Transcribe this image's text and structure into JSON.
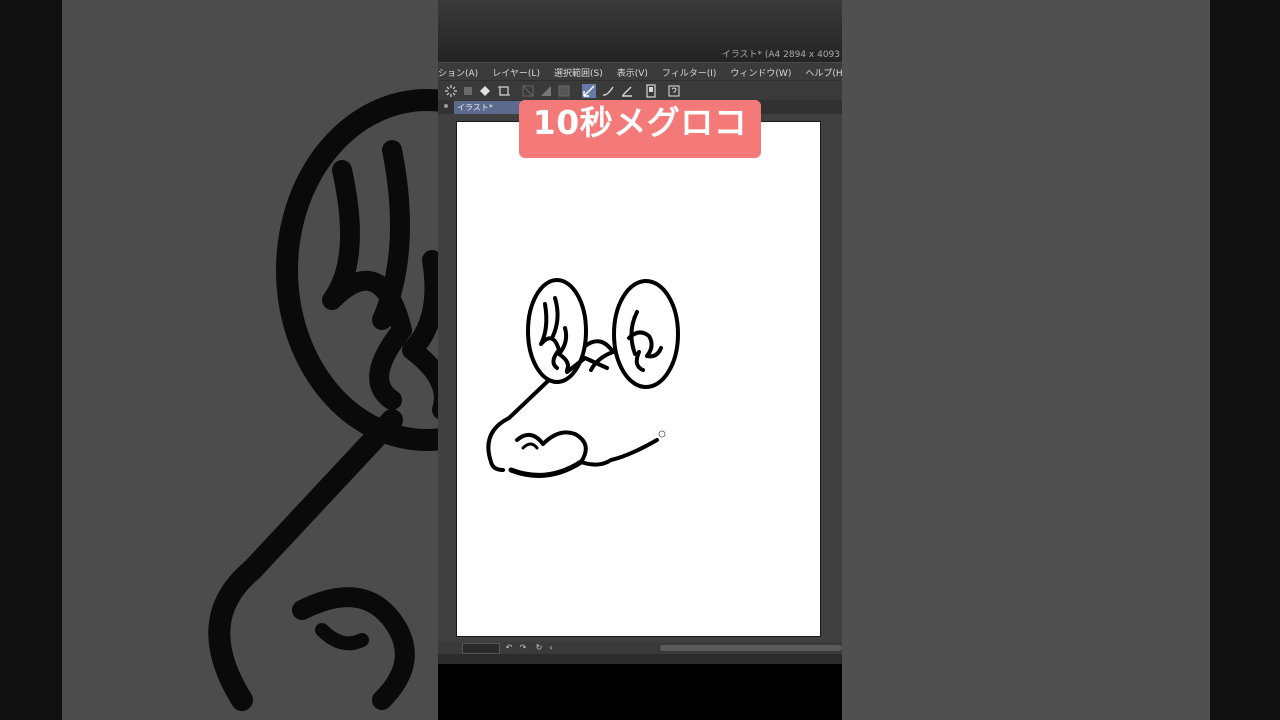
{
  "window": {
    "title": "イラスト* (A4 2894 x 4093"
  },
  "menu": [
    {
      "label": "ション(A)"
    },
    {
      "label": "レイヤー(L)"
    },
    {
      "label": "選択範囲(S)"
    },
    {
      "label": "表示(V)"
    },
    {
      "label": "フィルター(I)"
    },
    {
      "label": "ウィンドウ(W)"
    },
    {
      "label": "ヘルプ(H)"
    }
  ],
  "tab": {
    "label": "イラスト*"
  },
  "caption": {
    "text": "10秒メグロコ"
  },
  "colors": {
    "caption_bg": "#f47a7a",
    "tab_active": "#5c6a8e",
    "tool_active": "#6a7aa8",
    "ink": "#000000"
  },
  "toolbar_icons": [
    "spinner-icon",
    "square-icon",
    "fill-bucket-icon",
    "crop-icon",
    "no-fill-icon",
    "gradient-icon",
    "stop-icon",
    "pen-check-icon",
    "brush-icon",
    "ruler-pen-icon",
    "phone-icon",
    "help-icon"
  ],
  "statusbar_icons": [
    "undo-icon",
    "redo-icon",
    "rotate-icon",
    "reset-icon"
  ]
}
